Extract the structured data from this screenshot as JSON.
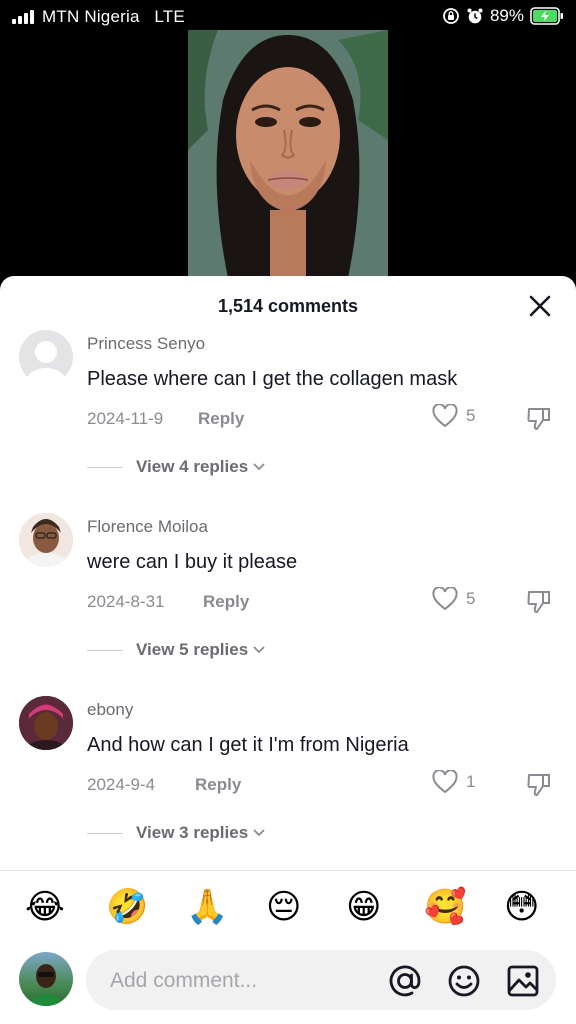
{
  "status_bar": {
    "carrier": "MTN Nigeria",
    "network": "LTE",
    "battery": "89%"
  },
  "sheet": {
    "title": "1,514 comments"
  },
  "comments": [
    {
      "name": "Princess Senyo",
      "text": "Please where can I get the collagen mask",
      "date": "2024-11-9",
      "reply_label": "Reply",
      "likes": "5",
      "view_replies": "View 4 replies"
    },
    {
      "name": "Florence Moiloa",
      "text": "were can I buy it please",
      "date": "2024-8-31",
      "reply_label": "Reply",
      "likes": "5",
      "view_replies": "View 5 replies"
    },
    {
      "name": "ebony",
      "text": "And how can I get it I'm from Nigeria",
      "date": "2024-9-4",
      "reply_label": "Reply",
      "likes": "1",
      "view_replies": "View 3 replies"
    }
  ],
  "emojis": [
    "😂",
    "🤣",
    "🙏",
    "😔",
    "😁",
    "🥰",
    "😳"
  ],
  "input": {
    "placeholder": "Add comment..."
  },
  "colors": {
    "text_primary": "#161823",
    "text_secondary": "#8a8b91",
    "battery_green": "#4cd964"
  },
  "icons": [
    "close-icon",
    "heart-icon",
    "dislike-icon",
    "chevron-down-icon",
    "mention-icon",
    "emoji-icon",
    "image-icon"
  ]
}
